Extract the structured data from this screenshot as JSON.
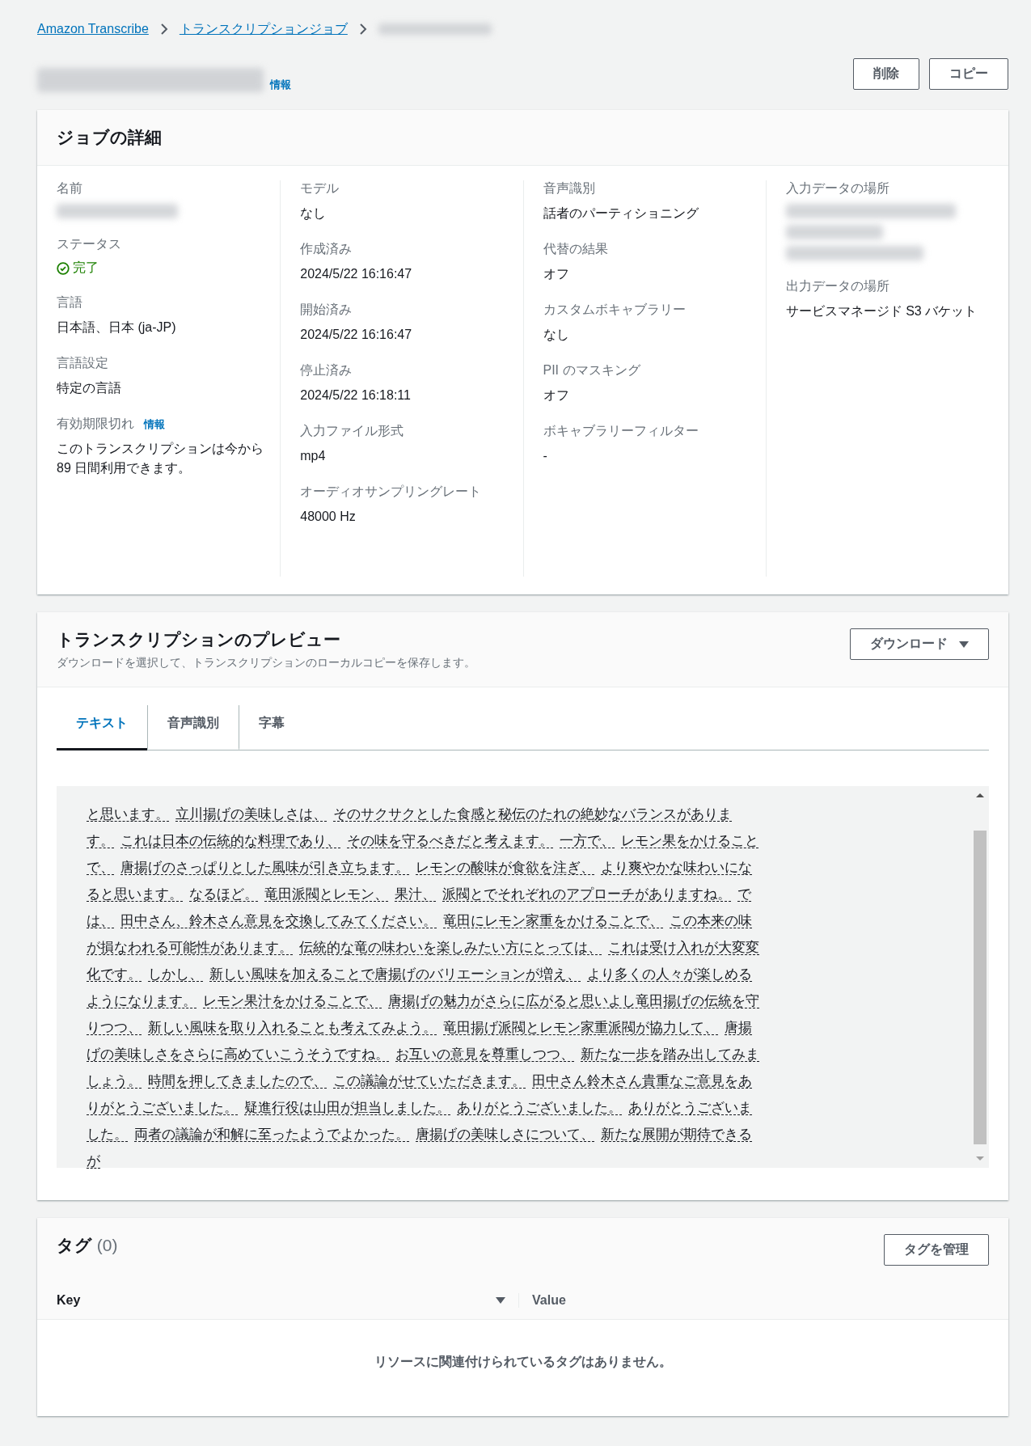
{
  "breadcrumbs": [
    {
      "label": "Amazon Transcribe",
      "kind": "link"
    },
    {
      "label": "トランスクリプションジョブ",
      "kind": "link"
    },
    {
      "kind": "redacted"
    }
  ],
  "header": {
    "info": "情報",
    "buttons": [
      "削除",
      "コピー"
    ]
  },
  "details": {
    "title": "ジョブの詳細",
    "columns": [
      [
        {
          "label": "名前",
          "kind": "redacted"
        },
        {
          "label": "ステータス",
          "kind": "status",
          "value": "完了"
        },
        {
          "label": "言語",
          "kind": "text",
          "value": "日本語、日本 (ja-JP)"
        },
        {
          "label": "言語設定",
          "kind": "text",
          "value": "特定の言語"
        },
        {
          "label": "有効期限切れ",
          "info": "情報",
          "kind": "text",
          "value": "このトランスクリプションは今から 89 日間利用できます。"
        }
      ],
      [
        {
          "label": "モデル",
          "kind": "text",
          "value": "なし"
        },
        {
          "label": "作成済み",
          "kind": "text",
          "value": "2024/5/22 16:16:47"
        },
        {
          "label": "開始済み",
          "kind": "text",
          "value": "2024/5/22 16:16:47"
        },
        {
          "label": "停止済み",
          "kind": "text",
          "value": "2024/5/22 16:18:11"
        },
        {
          "label": "入力ファイル形式",
          "kind": "text",
          "value": "mp4"
        },
        {
          "label": "オーディオサンプリングレート",
          "kind": "text",
          "value": "48000 Hz"
        }
      ],
      [
        {
          "label": "音声識別",
          "kind": "text",
          "value": "話者のパーティショニング"
        },
        {
          "label": "代替の結果",
          "kind": "text",
          "value": "オフ"
        },
        {
          "label": "カスタムボキャブラリー",
          "kind": "text",
          "value": "なし"
        },
        {
          "label": "PII のマスキング",
          "kind": "text",
          "value": "オフ"
        },
        {
          "label": "ボキャブラリーフィルター",
          "kind": "text",
          "value": "-"
        }
      ],
      [
        {
          "label": "入力データの場所",
          "kind": "redacted_link"
        },
        {
          "label": "出力データの場所",
          "kind": "text",
          "value": "サービスマネージド S3 バケット"
        }
      ]
    ]
  },
  "preview": {
    "title": "トランスクリプションのプレビュー",
    "description": "ダウンロードを選択して、トランスクリプションのローカルコピーを保存します。",
    "download_button": "ダウンロード",
    "tabs": [
      {
        "label": "テキスト",
        "selected": true
      },
      {
        "label": "音声識別",
        "selected": false
      },
      {
        "label": "字幕",
        "selected": false
      }
    ],
    "segments": [
      "と思います。",
      "立川揚げの美味しさは、",
      "そのサクサクとした食感と秘伝のたれの絶妙なバランスがあります。",
      "これは日本の伝統的な料理であり、",
      "その味を守るべきだと考えます。",
      "一方で、",
      "レモン果をかけることで、",
      "唐揚げのさっぱりとした風味が引き立ちます。",
      "レモンの酸味が食欲を注ぎ、",
      "より爽やかな味わいになると思います。",
      "なるほど。",
      "竜田派閥とレモン、",
      "果汁、",
      "派閥とでそれぞれのアプローチがありますね。",
      "では、",
      "田中さん、鈴木さん意見を交換してみてください。",
      "竜田にレモン家重をかけることで、",
      "この本来の味が損なわれる可能性があります。",
      "伝統的な竜の味わいを楽しみたい方にとっては、",
      "これは受け入れが大変変化です。",
      "しかし、",
      "新しい風味を加えることで唐揚げのバリエーションが増え、",
      "より多くの人々が楽しめるようになります。",
      "レモン果汁をかけることで、",
      "唐揚げの魅力がさらに広がると思いよし竜田揚げの伝統を守りつつ、",
      "新しい風味を取り入れることも考えてみよう。",
      "竜田揚げ派閥とレモン家重派閥が協力して、",
      "唐揚げの美味しさをさらに高めていこうそうですね。",
      "お互いの意見を尊重しつつ、",
      "新たな一歩を踏み出してみましょう。",
      "時間を押してきましたので、",
      "この議論がせていただきます。",
      "田中さん鈴木さん貴重なご意見をありがとうございました。",
      "疑進行役は山田が担当しました。",
      "ありがとうございました。",
      "ありがとうございました。",
      "両者の議論が和解に至ったようでよかった。",
      "唐揚げの美味しさについて、",
      "新たな展開が期待できるが"
    ]
  },
  "tags": {
    "title": "タグ",
    "count": "(0)",
    "manage_button": "タグを管理",
    "columns": [
      "Key",
      "Value"
    ],
    "empty": "リソースに関連付けられているタグはありません。"
  }
}
